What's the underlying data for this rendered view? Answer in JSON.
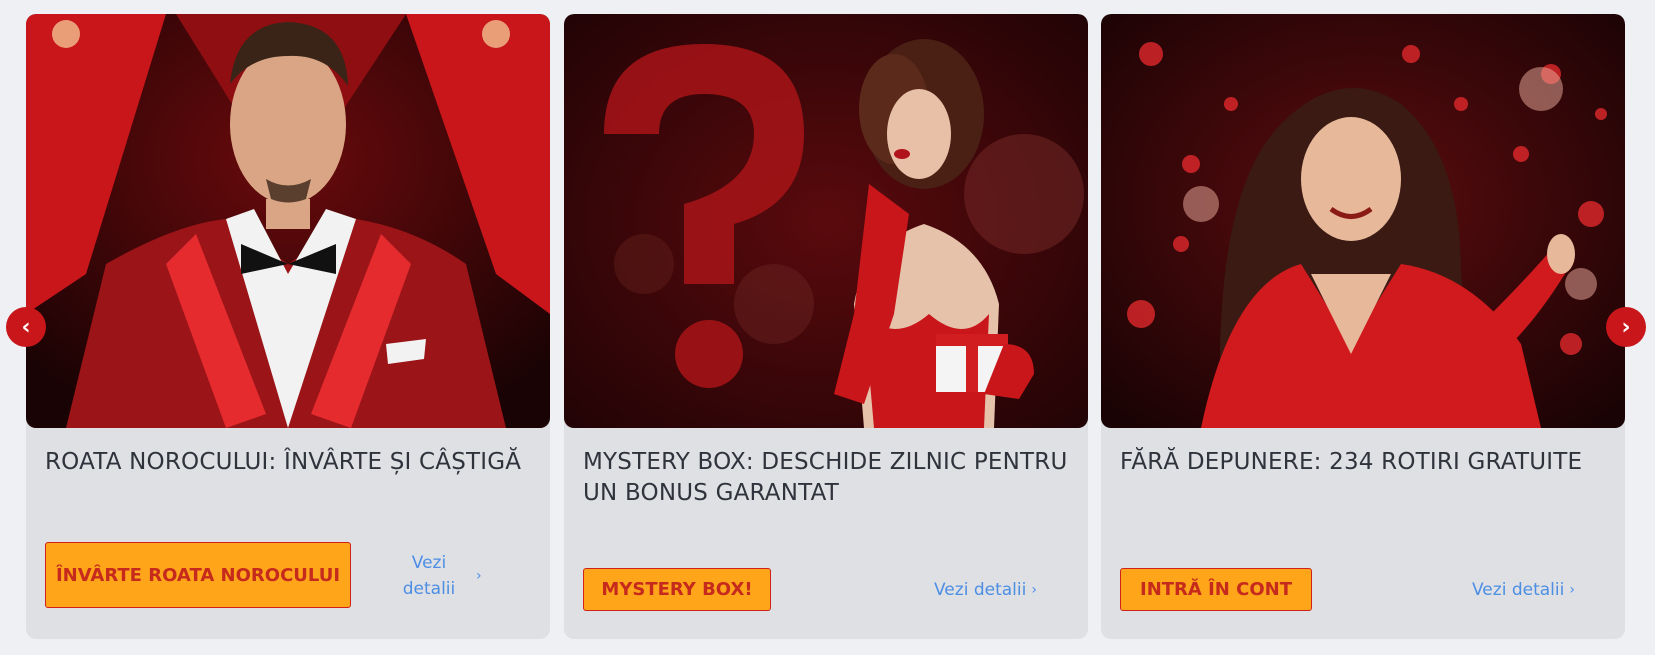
{
  "cards": [
    {
      "title": "ROATA NOROCULUI: ÎNVÂRTE ȘI CÂȘTIGĂ",
      "button": "ÎNVÂRTE ROATA NOROCULUI",
      "details": "Vezi detalii",
      "image": "man-in-red-tuxedo"
    },
    {
      "title": "MYSTERY BOX: DESCHIDE ZILNIC PENTRU UN BONUS GARANTAT",
      "button": "MYSTERY BOX!",
      "details": "Vezi detalii",
      "image": "woman-with-gift-box"
    },
    {
      "title": "FĂRĂ DEPUNERE: 234 ROTIRI GRATUITE",
      "button": "INTRĂ ÎN CONT",
      "details": "Vezi detalii",
      "image": "woman-with-casino-chips"
    }
  ],
  "nav": {
    "prev_icon": "chevron-left-icon",
    "next_icon": "chevron-right-icon"
  },
  "colors": {
    "button_bg": "#fea51a",
    "button_text": "#c62a1d",
    "link": "#4c8ee4",
    "arrow_bg": "#c8161b"
  }
}
